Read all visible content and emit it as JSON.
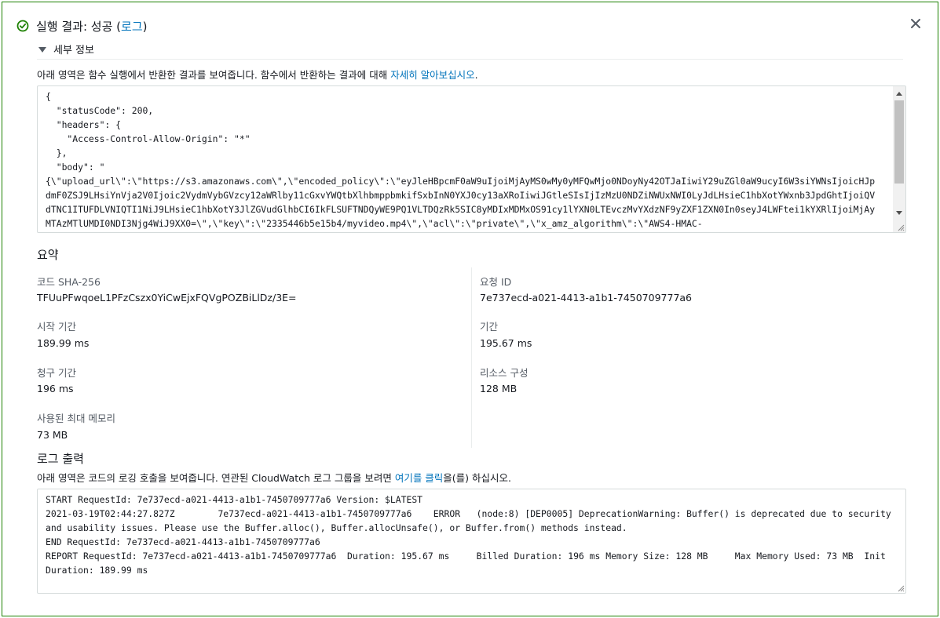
{
  "header": {
    "title_prefix": "실행 결과: 성공 (",
    "log_link": "로그",
    "title_suffix": ")"
  },
  "details": {
    "toggle_label": "세부 정보",
    "description": "아래 영역은 함수 실행에서 반환한 결과를 보여줍니다. 함수에서 반환하는 결과에 대해 ",
    "learn_more_link": "자세히 알아보십시오",
    "description_end": ".",
    "result_lines": [
      "{",
      "  \"statusCode\": 200,",
      "  \"headers\": {",
      "    \"Access-Control-Allow-Origin\": \"*\"",
      "  },",
      "  \"body\": \"",
      "{\\\"upload_url\\\":\\\"https://s3.amazonaws.com\\\",\\\"encoded_policy\\\":\\\"eyJleHBpcmF0aW9uIjoiMjAyMS0wMy0yMFQwMjo0NDoyNy42OTJaIiwiY29uZGl0aW9ucyI6W3siYWNsIjoicHJp",
      "dmF0ZSJ9LHsiYnVja2V0Ijoic2VydmVybGVzcy12aWRlby11cGxvYWQtbXlhbmppbmkifSxbInN0YXJ0cy13aXRoIiwiJGtleSIsIjIzMzU0NDZiNWUxNWI0LyJdLHsieC1hbXotYWxnb3JpdGhtIjoiQV",
      "dTNC1ITUFDLVNIQTI1NiJ9LHsieC1hbXotY3JlZGVudGlhbCI6IkFLSUFTNDQyWE9PQ1VLTDQzRk5SIC8yMDIxMDMxOS91cy1lYXN0LTEvczMvYXdzNF9yZXF1ZXN0In0seyJ4LWFtei1kYXRlIjoiMjAy",
      "MTAzMTlUMDI0NDI3Njg4WiJ9XX0=\\\",\\\"key\\\":\\\"2335446b5e15b4/myvideo.mp4\\\",\\\"acl\\\":\\\"private\\\",\\\"x_amz_algorithm\\\":\\\"AWS4-HMAC-"
    ]
  },
  "summary": {
    "title": "요약",
    "items": [
      {
        "label": "코드 SHA-256",
        "value": "TFUuPFwqoeL1PFzCszx0YiCwEjxFQVgPOZBiLlDz/3E="
      },
      {
        "label": "요청 ID",
        "value": "7e737ecd-a021-4413-a1b1-7450709777a6"
      },
      {
        "label": "시작 기간",
        "value": "189.99 ms"
      },
      {
        "label": "기간",
        "value": "195.67 ms"
      },
      {
        "label": "청구 기간",
        "value": "196 ms"
      },
      {
        "label": "리소스 구성",
        "value": "128 MB"
      },
      {
        "label": "사용된 최대 메모리",
        "value": "73 MB"
      }
    ]
  },
  "log_output": {
    "title": "로그 출력",
    "description": "아래 영역은 코드의 로깅 호출을 보여줍니다. 연관된 CloudWatch 로그 그룹을 보려면 ",
    "click_link": "여기를 클릭",
    "description_end": "을(를) 하십시오.",
    "lines": [
      "START RequestId: 7e737ecd-a021-4413-a1b1-7450709777a6 Version: $LATEST",
      "2021-03-19T02:44:27.827Z\t7e737ecd-a021-4413-a1b1-7450709777a6\tERROR\t(node:8) [DEP0005] DeprecationWarning: Buffer() is deprecated due to security and usability issues. Please use the Buffer.alloc(), Buffer.allocUnsafe(), or Buffer.from() methods instead.",
      "END RequestId: 7e737ecd-a021-4413-a1b1-7450709777a6",
      "REPORT RequestId: 7e737ecd-a021-4413-a1b1-7450709777a6\tDuration: 195.67 ms\tBilled Duration: 196 ms\tMemory Size: 128 MB\tMax Memory Used: 73 MB\tInit Duration: 189.99 ms"
    ]
  },
  "colors": {
    "success": "#1d8102",
    "link": "#0073bb",
    "text": "#16191f",
    "label": "#545b64"
  }
}
